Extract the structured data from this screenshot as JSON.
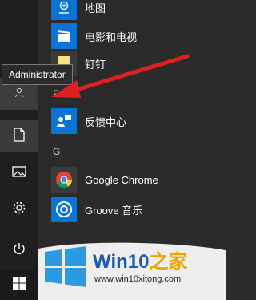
{
  "tooltip": {
    "text": "Administrator"
  },
  "apps": [
    {
      "label": "地图",
      "icon": "maps-icon"
    },
    {
      "label": "电影和电视",
      "icon": "movies-tv-icon"
    },
    {
      "label": "钉钉",
      "icon": "dingtalk-icon"
    },
    {
      "label": "反馈中心",
      "icon": "feedback-hub-icon"
    },
    {
      "label": "Google Chrome",
      "icon": "chrome-icon"
    },
    {
      "label": "Groove 音乐",
      "icon": "groove-music-icon"
    }
  ],
  "section_letters": [
    "F",
    "G"
  ],
  "rail": {
    "user_icon": "user-icon",
    "documents_icon": "document-icon",
    "pictures_icon": "pictures-icon",
    "settings_icon": "gear-icon",
    "power_icon": "power-icon",
    "start_icon": "windows-start-icon"
  },
  "watermark": {
    "brand_prefix": "Win10",
    "brand_suffix": "之家",
    "url": "www.win10xitong.com"
  },
  "colors": {
    "tile_blue": "#0a74d6",
    "arrow_red": "#e02020",
    "brand_blue": "#1e5da8",
    "brand_orange": "#f1a400"
  }
}
